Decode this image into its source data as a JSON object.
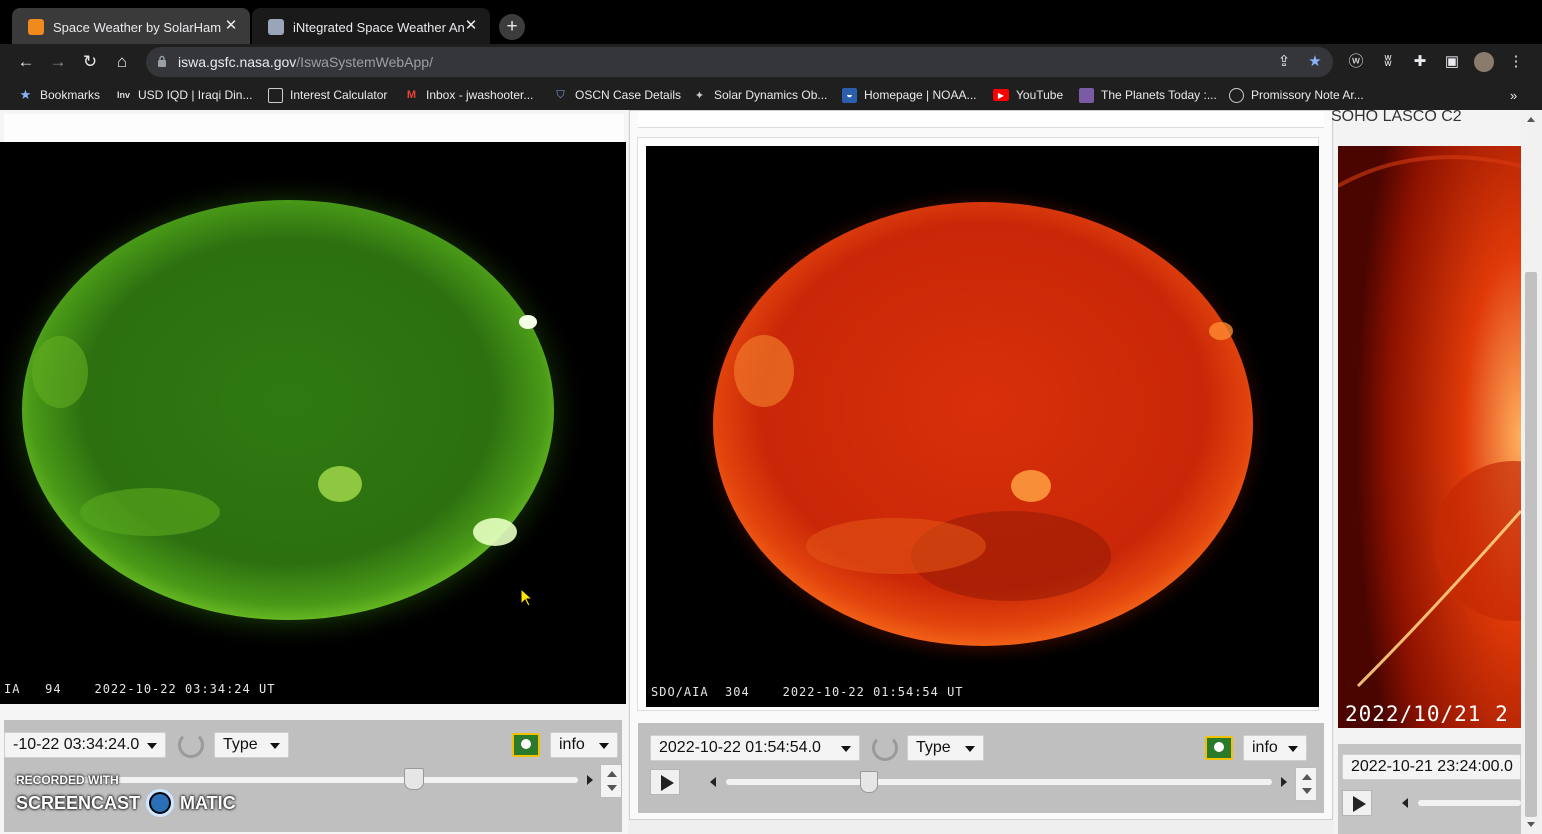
{
  "tabs": [
    {
      "title": "Space Weather by SolarHam",
      "active": true
    },
    {
      "title": "iNtegrated Space Weather Analy",
      "active": false
    }
  ],
  "address": {
    "host": "iswa.gsfc.nasa.gov",
    "path": "/IswaSystemWebApp/"
  },
  "bookmarks": [
    {
      "label": "Bookmarks",
      "icon": "star-icon"
    },
    {
      "label": "USD IQD | Iraqi Din...",
      "icon": "investing-icon"
    },
    {
      "label": "Interest Calculator",
      "icon": "calculator-icon"
    },
    {
      "label": "Inbox - jwashooter...",
      "icon": "gmail-icon"
    },
    {
      "label": "OSCN Case Details",
      "icon": "shield-icon"
    },
    {
      "label": "Solar Dynamics Ob...",
      "icon": "satellite-icon"
    },
    {
      "label": "Homepage | NOAA...",
      "icon": "noaa-icon"
    },
    {
      "label": "YouTube",
      "icon": "youtube-icon"
    },
    {
      "label": "The Planets Today :...",
      "icon": "planets-icon"
    },
    {
      "label": "Promissory Note Ar...",
      "icon": "document-icon"
    }
  ],
  "bookmarks_overflow": "»",
  "panels": {
    "left": {
      "caption": "IA   94    2022-10-22 03:34:24 UT",
      "time_select": "-10-22 03:34:24.0",
      "type_label": "Type",
      "info_label": "info"
    },
    "middle": {
      "caption": "SDO/AIA  304    2022-10-22 01:54:54 UT",
      "time_select": "2022-10-22 01:54:54.0",
      "type_label": "Type",
      "info_label": "info"
    },
    "right": {
      "title": "SOHO LASCO C2",
      "overlay_date": "2022/10/21 2",
      "time_select": "2022-10-21 23:24:00.0"
    }
  },
  "watermark": {
    "line1": "RECORDED WITH",
    "line2a": "SCREENCAST",
    "line2b": "MATIC"
  },
  "colors": {
    "aia94": "#3f9a14",
    "aia304": "#d42a08",
    "lasco": "#c41f00"
  }
}
